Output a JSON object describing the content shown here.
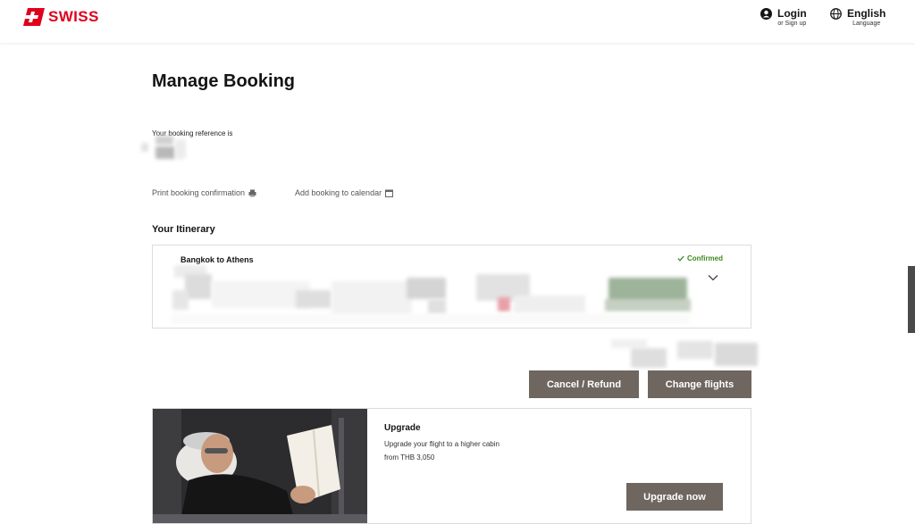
{
  "header": {
    "brand": "SWISS",
    "login": {
      "label": "Login",
      "sub": "or Sign up"
    },
    "language": {
      "label": "English",
      "sub": "Language"
    }
  },
  "page": {
    "title": "Manage Booking",
    "reference_label": "Your booking reference is"
  },
  "links": {
    "print": "Print booking confirmation",
    "calendar": "Add booking to calendar"
  },
  "itinerary": {
    "heading": "Your Itinerary",
    "route": "Bangkok to Athens",
    "status": "Confirmed"
  },
  "actions": {
    "cancel": "Cancel / Refund",
    "change": "Change flights"
  },
  "upgrade": {
    "title": "Upgrade",
    "description": "Upgrade your flight to a higher cabin",
    "price": "from THB 3,050",
    "button": "Upgrade now"
  },
  "colors": {
    "brand_red": "#e0001b",
    "button_bg": "#6f6660",
    "confirmed_green": "#3e8a1e"
  },
  "icons": {
    "logo": "swiss-cross-icon",
    "login": "user-circle-icon",
    "language": "globe-icon",
    "print": "printer-icon",
    "calendar": "calendar-icon",
    "status": "check-icon",
    "expand": "chevron-down-icon"
  }
}
